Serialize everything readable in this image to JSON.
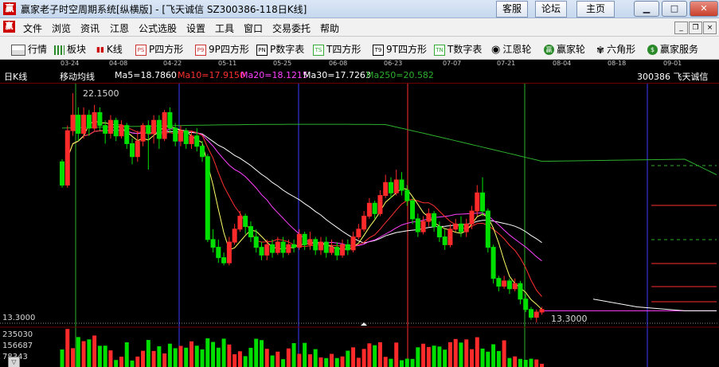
{
  "window": {
    "title": "赢家老子时空周期系统[纵横版] - [飞天诚信  SZ300386-118日K线]",
    "logo": "赢",
    "buttons": [
      "客服",
      "论坛",
      "主页"
    ]
  },
  "menubar": {
    "logo": "赢",
    "items": [
      "文件",
      "浏览",
      "资讯",
      "江恩",
      "公式选股",
      "设置",
      "工具",
      "窗口",
      "交易委托",
      "帮助"
    ],
    "controls": [
      "_",
      "❐",
      "×"
    ]
  },
  "toolbar": {
    "items": [
      {
        "label": "行情",
        "icon": "chart-icon"
      },
      {
        "label": "板块",
        "icon": "grid-icon"
      },
      {
        "label": "K线",
        "icon": "candlestick-icon"
      },
      {
        "label": "P四方形",
        "icon": "p-box-icon",
        "badge": "PS"
      },
      {
        "label": "9P四方形",
        "icon": "9p-box-icon",
        "badge": "P9"
      },
      {
        "label": "P数字表",
        "icon": "pn-box-icon",
        "badge": "PN"
      },
      {
        "label": "T四方形",
        "icon": "t-box-icon",
        "badge": "TS"
      },
      {
        "label": "9T四方形",
        "icon": "9t-box-icon",
        "badge": "T9"
      },
      {
        "label": "T数字表",
        "icon": "tn-box-icon",
        "badge": "TN"
      },
      {
        "label": "江恩轮",
        "icon": "gann-wheel-icon"
      },
      {
        "label": "赢家轮",
        "icon": "winner-wheel-icon",
        "badge": "赢"
      },
      {
        "label": "六角形",
        "icon": "hexagon-icon"
      },
      {
        "label": "赢家服务",
        "icon": "dollar-icon",
        "badge": "$"
      }
    ]
  },
  "chart": {
    "dates": [
      "03-24",
      "04-08",
      "04-22",
      "05-11",
      "05-25",
      "06-08",
      "06-23",
      "07-07",
      "07-21",
      "08-04",
      "08-18",
      "09-01"
    ],
    "period": "日K线",
    "indicator": "移动均线",
    "ma": [
      {
        "label": "Ma5=18.7860",
        "color": "#ffffff"
      },
      {
        "label": "Ma10=17.9150",
        "color": "#ff3030"
      },
      {
        "label": "Ma20=18.1215",
        "color": "#ff40ff"
      },
      {
        "label": "Ma30=17.7263",
        "color": "#ffffff"
      },
      {
        "label": "Ma250=20.582",
        "color": "#2db02d"
      }
    ],
    "stock": "300386 飞天诚信",
    "high_label": "22.1500",
    "low_label": "13.3000",
    "axis_low": "13.3000",
    "volume_labels": [
      "235030",
      "156687",
      "78343"
    ]
  },
  "chart_data": {
    "type": "candlestick",
    "price_range": [
      13.3,
      22.15
    ],
    "ylim": [
      13.3,
      22.15
    ],
    "candles": [
      [
        19.5,
        18.6,
        19.6,
        18.5
      ],
      [
        18.6,
        20.7,
        20.9,
        18.5
      ],
      [
        20.7,
        21.3,
        22.15,
        20.5
      ],
      [
        21.3,
        20.6,
        21.6,
        20.3
      ],
      [
        20.6,
        21.3,
        21.6,
        20.4
      ],
      [
        21.3,
        20.8,
        21.5,
        20.5
      ],
      [
        20.8,
        21.4,
        21.7,
        20.7
      ],
      [
        21.4,
        20.9,
        21.6,
        20.7
      ],
      [
        20.9,
        20.6,
        21.1,
        20.2
      ],
      [
        20.6,
        21.1,
        21.3,
        20.4
      ],
      [
        21.1,
        20.5,
        21.2,
        20.3
      ],
      [
        20.5,
        20.9,
        21.1,
        20.4
      ],
      [
        20.9,
        20.2,
        21.0,
        20.0
      ],
      [
        20.2,
        19.7,
        20.4,
        19.4
      ],
      [
        19.7,
        20.3,
        20.7,
        19.5
      ],
      [
        20.3,
        20.9,
        21.0,
        20.1
      ],
      [
        20.9,
        20.6,
        21.1,
        19.2
      ],
      [
        20.6,
        21.1,
        21.3,
        20.2
      ],
      [
        21.1,
        20.4,
        21.3,
        20.0
      ],
      [
        20.4,
        21.4,
        21.5,
        20.3
      ],
      [
        21.4,
        20.8,
        21.6,
        20.6
      ],
      [
        20.8,
        20.3,
        21.0,
        20.1
      ],
      [
        20.3,
        20.7,
        20.9,
        20.1
      ],
      [
        20.7,
        20.2,
        20.8,
        20.0
      ],
      [
        20.2,
        20.5,
        20.7,
        20.0
      ],
      [
        20.5,
        20.1,
        20.8,
        19.9
      ],
      [
        20.1,
        19.7,
        20.3,
        19.5
      ],
      [
        19.7,
        16.5,
        19.8,
        16.4
      ],
      [
        16.5,
        16.2,
        16.9,
        16.0
      ],
      [
        16.2,
        15.8,
        16.5,
        15.6
      ],
      [
        15.8,
        15.6,
        16.0,
        15.5
      ],
      [
        15.6,
        16.4,
        16.6,
        15.5
      ],
      [
        16.4,
        16.9,
        17.1,
        16.3
      ],
      [
        16.9,
        17.4,
        17.6,
        16.8
      ],
      [
        17.4,
        17.0,
        17.5,
        16.7
      ],
      [
        17.0,
        16.6,
        17.2,
        16.4
      ],
      [
        16.6,
        16.2,
        16.9,
        16.0
      ],
      [
        16.2,
        15.9,
        16.4,
        15.7
      ],
      [
        15.9,
        16.3,
        16.5,
        15.7
      ],
      [
        16.3,
        16.0,
        16.5,
        15.8
      ],
      [
        16.0,
        16.4,
        16.6,
        15.9
      ],
      [
        16.4,
        16.0,
        16.6,
        15.8
      ],
      [
        16.0,
        16.3,
        16.5,
        15.9
      ],
      [
        16.3,
        16.2,
        16.5,
        16.0
      ],
      [
        16.2,
        16.7,
        16.9,
        16.1
      ],
      [
        16.7,
        16.3,
        16.8,
        16.1
      ],
      [
        16.3,
        16.5,
        16.8,
        16.1
      ],
      [
        16.5,
        16.1,
        16.6,
        15.9
      ],
      [
        16.1,
        16.4,
        16.6,
        15.9
      ],
      [
        16.4,
        16.0,
        16.6,
        15.8
      ],
      [
        16.0,
        16.2,
        16.5,
        15.9
      ],
      [
        16.2,
        15.9,
        16.4,
        15.7
      ],
      [
        15.9,
        16.3,
        16.5,
        15.8
      ],
      [
        16.3,
        16.1,
        16.5,
        15.9
      ],
      [
        16.1,
        16.6,
        16.8,
        16.0
      ],
      [
        16.6,
        16.9,
        17.1,
        16.5
      ],
      [
        16.9,
        17.4,
        17.6,
        16.8
      ],
      [
        17.4,
        17.9,
        18.1,
        17.3
      ],
      [
        17.9,
        17.5,
        18.0,
        17.3
      ],
      [
        17.5,
        18.2,
        18.4,
        17.4
      ],
      [
        18.2,
        18.7,
        19.0,
        18.1
      ],
      [
        18.7,
        18.3,
        18.9,
        18.1
      ],
      [
        18.3,
        18.8,
        19.2,
        18.2
      ],
      [
        18.8,
        18.4,
        19.1,
        18.2
      ],
      [
        18.4,
        18.0,
        18.6,
        17.8
      ],
      [
        18.0,
        17.3,
        18.1,
        17.1
      ],
      [
        17.3,
        16.8,
        17.5,
        16.6
      ],
      [
        16.8,
        17.2,
        17.4,
        16.7
      ],
      [
        17.2,
        17.5,
        17.7,
        17.0
      ],
      [
        17.5,
        17.0,
        17.6,
        16.8
      ],
      [
        17.0,
        16.6,
        17.2,
        16.4
      ],
      [
        16.6,
        16.3,
        16.9,
        16.1
      ],
      [
        16.3,
        16.9,
        17.1,
        16.2
      ],
      [
        16.9,
        17.1,
        17.3,
        16.8
      ],
      [
        17.1,
        16.8,
        17.4,
        16.6
      ],
      [
        16.8,
        17.1,
        17.3,
        16.6
      ],
      [
        17.1,
        17.6,
        17.8,
        16.9
      ],
      [
        17.6,
        18.3,
        18.6,
        17.4
      ],
      [
        18.3,
        17.6,
        18.9,
        17.4
      ],
      [
        17.6,
        16.2,
        17.7,
        16.0
      ],
      [
        16.2,
        15.0,
        16.3,
        14.8
      ],
      [
        15.0,
        14.7,
        15.1,
        14.5
      ],
      [
        14.7,
        14.9,
        15.1,
        14.6
      ],
      [
        14.9,
        14.6,
        15.0,
        14.4
      ],
      [
        14.6,
        14.8,
        15.0,
        14.5
      ],
      [
        14.8,
        14.2,
        14.9,
        14.0
      ],
      [
        14.2,
        13.8,
        14.4,
        13.7
      ],
      [
        13.8,
        13.5,
        13.9,
        13.4
      ],
      [
        13.5,
        13.7,
        13.8,
        13.3
      ],
      [
        13.7,
        13.8,
        13.9,
        13.6
      ]
    ],
    "volume_ticks": [
      78343,
      156687,
      235030
    ]
  }
}
